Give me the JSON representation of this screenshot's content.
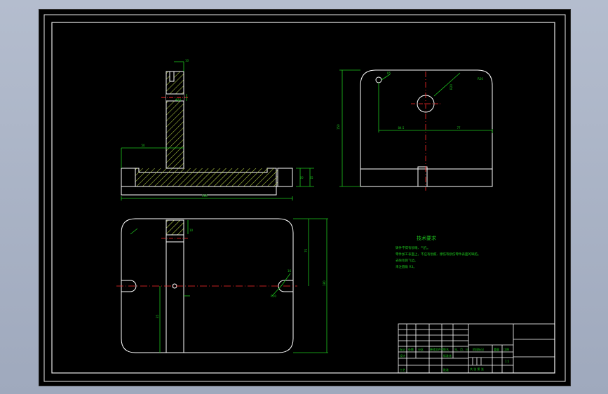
{
  "drawing": {
    "notes_title": "技术要求",
    "notes": [
      "铸件不得有砂眼、气孔。",
      "零件加工表面上，不应有划痕、擦伤等损伤零件表面的缺陷。",
      "去除毛刺飞边。",
      "未注圆角 R3。"
    ],
    "dims": {
      "front_overall_width": "260",
      "front_left_rise": "50",
      "front_right_h1": "20",
      "front_right_h2": "35",
      "front_top_slot": "10",
      "front_hole": "Φ10",
      "side_height": "150",
      "side_radius": "R20",
      "side_left": "84.5",
      "side_right": "77",
      "side_small_hole": "R5",
      "plan_total_height": "180",
      "plan_half_height": "75",
      "plan_slot_offset": "16",
      "plan_radius": "R10",
      "plan_left_dim": "35",
      "plan_top_small": "10"
    },
    "title_block": {
      "labels": [
        "标记",
        "处数",
        "分区",
        "更改文件号",
        "签名",
        "年、月、日"
      ],
      "label_design": "设计",
      "label_standard": "标准化",
      "label_process": "工艺",
      "label_approve": "批准",
      "label_stage": "阶段标记",
      "label_weight": "重量",
      "label_scale": "比例",
      "scale_value": "1:1",
      "label_sheet": "共 张 第 张"
    }
  }
}
